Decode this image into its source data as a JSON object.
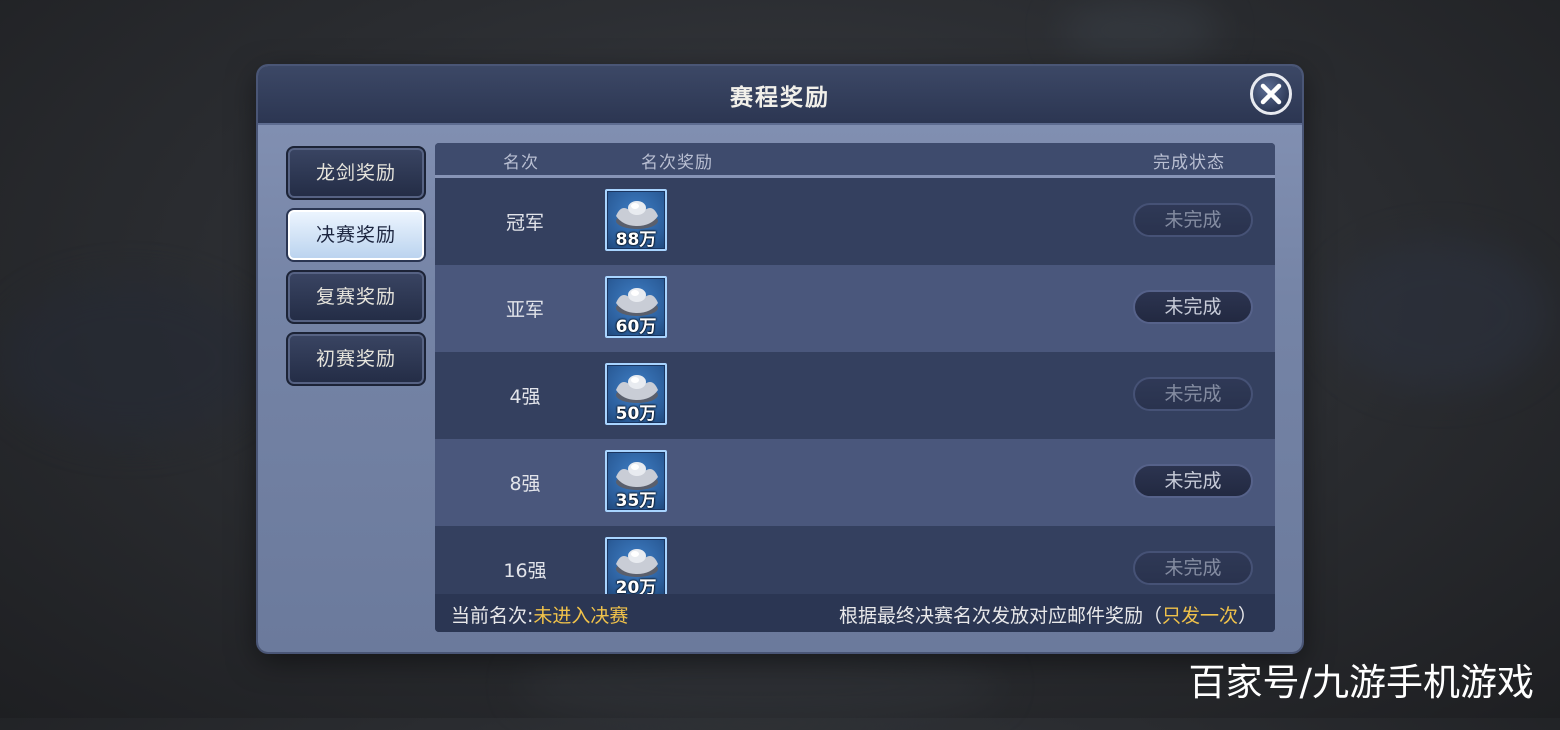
{
  "dialog": {
    "title": "赛程奖励"
  },
  "tabs": [
    {
      "label": "龙剑奖励",
      "active": false
    },
    {
      "label": "决赛奖励",
      "active": true
    },
    {
      "label": "复赛奖励",
      "active": false
    },
    {
      "label": "初赛奖励",
      "active": false
    }
  ],
  "table": {
    "headers": {
      "rank": "名次",
      "reward": "名次奖励",
      "status": "完成状态"
    },
    "rows": [
      {
        "rank": "冠军",
        "reward_qty": "88万",
        "reward_icon": "silver-ingot-icon",
        "status": "未完成"
      },
      {
        "rank": "亚军",
        "reward_qty": "60万",
        "reward_icon": "silver-ingot-icon",
        "status": "未完成"
      },
      {
        "rank": "4强",
        "reward_qty": "50万",
        "reward_icon": "silver-ingot-icon",
        "status": "未完成"
      },
      {
        "rank": "8强",
        "reward_qty": "35万",
        "reward_icon": "silver-ingot-icon",
        "status": "未完成"
      },
      {
        "rank": "16强",
        "reward_qty": "20万",
        "reward_icon": "silver-ingot-icon",
        "status": "未完成"
      }
    ]
  },
  "footer": {
    "current_label": "当前名次:",
    "current_value": "未进入决赛",
    "note_prefix": "根据最终决赛名次发放对应邮件奖励（",
    "note_highlight": "只发一次",
    "note_suffix": "）"
  },
  "watermark": "百家号/九游手机游戏",
  "colors": {
    "highlight": "#f0c24a",
    "active_tab": "#d7e8fb",
    "panel": "#7584a6"
  }
}
